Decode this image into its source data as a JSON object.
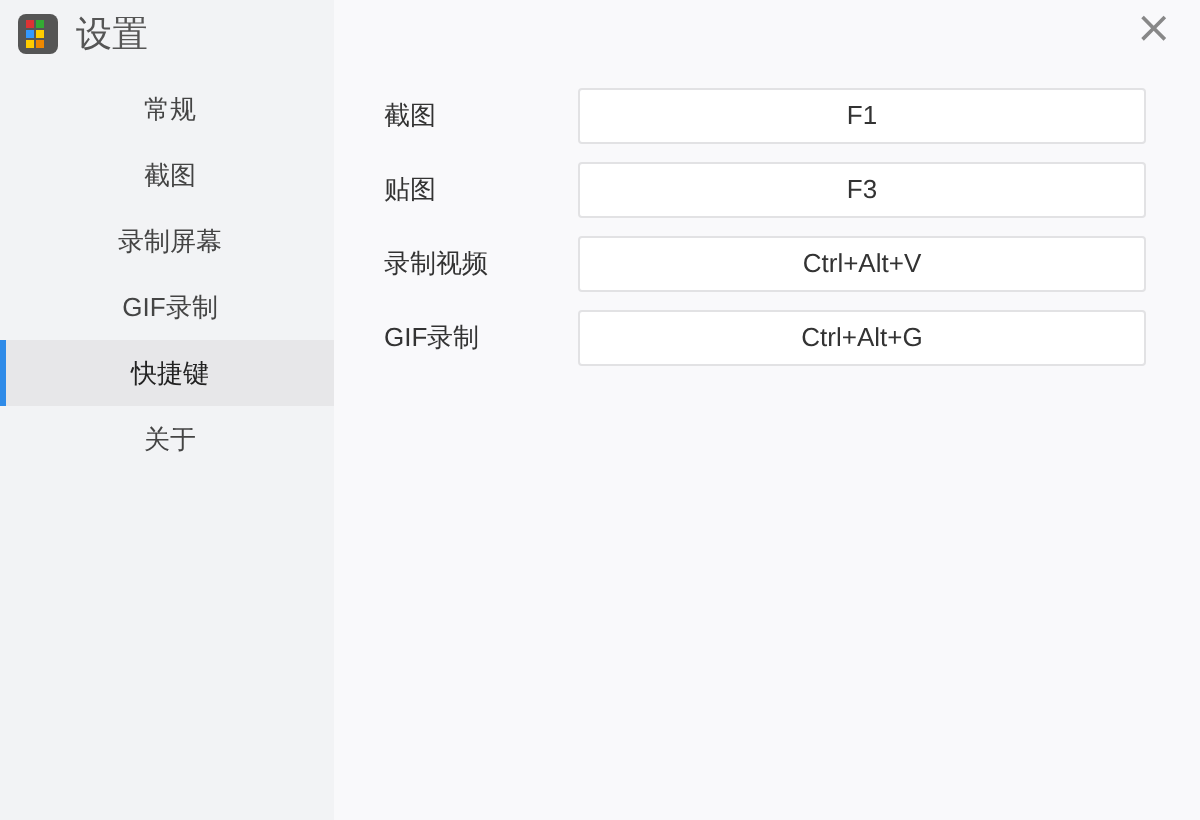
{
  "window": {
    "title": "设置",
    "close": "×"
  },
  "sidebar": {
    "items": [
      {
        "label": "常规",
        "selected": false
      },
      {
        "label": "截图",
        "selected": false
      },
      {
        "label": "录制屏幕",
        "selected": false
      },
      {
        "label": "GIF录制",
        "selected": false
      },
      {
        "label": "快捷键",
        "selected": true
      },
      {
        "label": "关于",
        "selected": false
      }
    ]
  },
  "shortcuts": [
    {
      "label": "截图",
      "value": "F1"
    },
    {
      "label": "贴图",
      "value": "F3"
    },
    {
      "label": "录制视频",
      "value": "Ctrl+Alt+V"
    },
    {
      "label": "GIF录制",
      "value": "Ctrl+Alt+G"
    }
  ]
}
